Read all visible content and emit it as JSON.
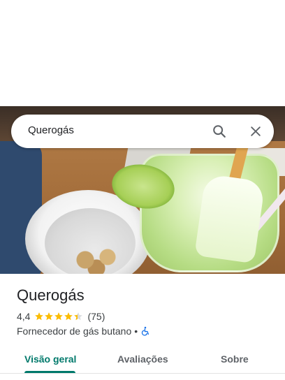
{
  "search": {
    "query": "Querogás",
    "search_icon": "search-icon",
    "close_icon": "close-icon"
  },
  "place": {
    "name": "Querogás",
    "rating": "4,4",
    "rating_value": 4.4,
    "rating_max": 5,
    "review_count": "(75)",
    "category": "Fornecedor de gás butano",
    "separator": "•",
    "accessibility_icon": "wheelchair-icon"
  },
  "tabs": [
    {
      "label": "Visão geral",
      "active": true
    },
    {
      "label": "Avaliações",
      "active": false
    },
    {
      "label": "Sobre",
      "active": false
    }
  ],
  "colors": {
    "accent": "#00796b",
    "star": "#fbbc04",
    "accessibility": "#1a73e8",
    "text_primary": "#202124",
    "text_secondary": "#3c4043"
  }
}
